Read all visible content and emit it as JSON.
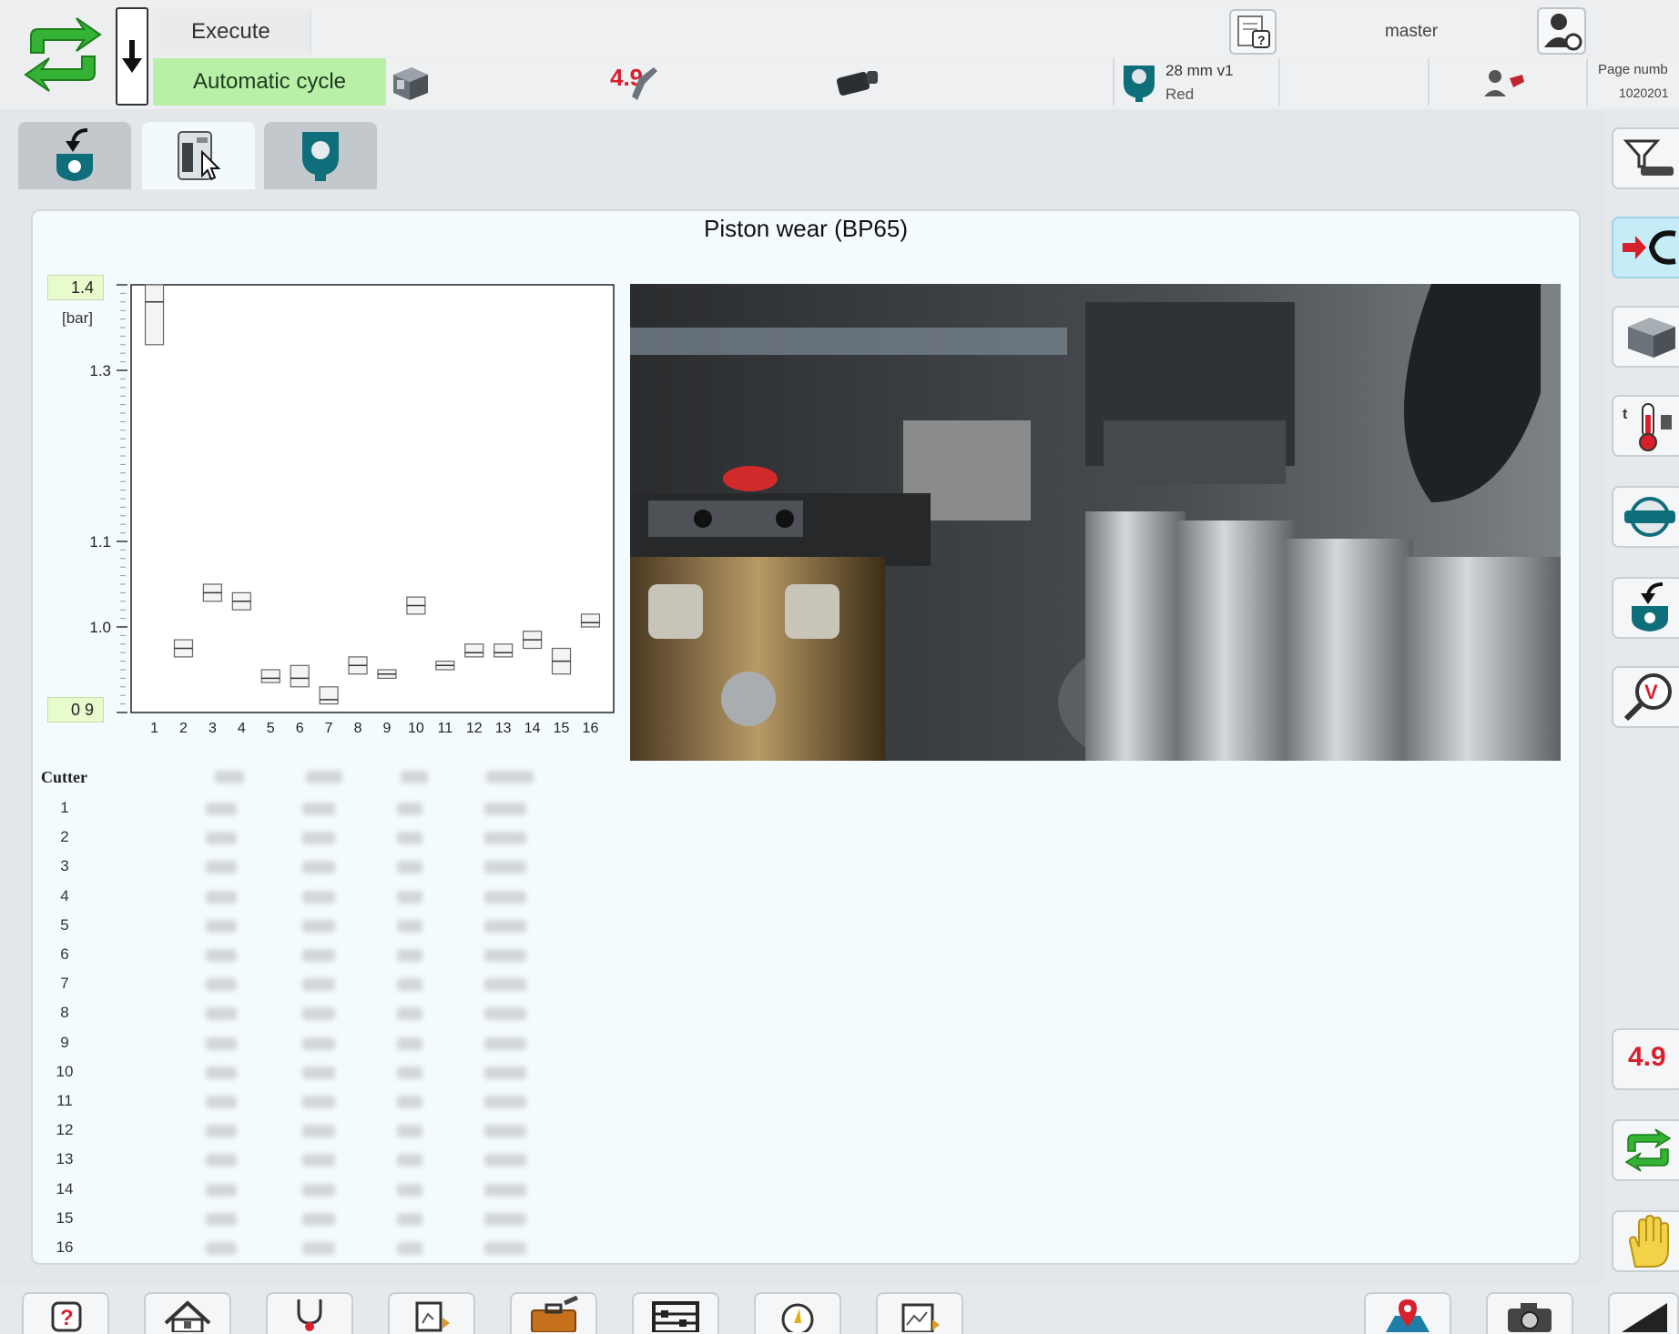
{
  "header": {
    "execute_label": "Execute",
    "mode_label": "Automatic cycle",
    "user_name": "master",
    "tool_line1": "28 mm v1",
    "tool_line2": "Red",
    "page_number_label": "Page numb",
    "page_number_value": "1020201",
    "tool_size_badge": "4.9"
  },
  "tabs": [
    {
      "name": "tool-change",
      "active": false
    },
    {
      "name": "machine-cabinet",
      "active": true
    },
    {
      "name": "spindle",
      "active": false
    }
  ],
  "panel": {
    "title": "Piston wear (BP65)"
  },
  "chart_data": {
    "type": "box",
    "title": "Piston wear (BP65)",
    "ylabel": "[bar]",
    "ylim": [
      0.9,
      1.4
    ],
    "ytick_labels": [
      "1.4",
      "1.3",
      "1.1",
      "1.0",
      "0 9"
    ],
    "yticks": [
      1.4,
      1.3,
      1.1,
      1.0,
      0.9
    ],
    "categories": [
      "1",
      "2",
      "3",
      "4",
      "5",
      "6",
      "7",
      "8",
      "9",
      "10",
      "11",
      "12",
      "13",
      "14",
      "15",
      "16"
    ],
    "boxes": [
      {
        "low": 1.33,
        "mid": 1.38,
        "high": 1.4
      },
      {
        "low": 0.965,
        "mid": 0.975,
        "high": 0.985
      },
      {
        "low": 1.03,
        "mid": 1.04,
        "high": 1.05
      },
      {
        "low": 1.02,
        "mid": 1.03,
        "high": 1.04
      },
      {
        "low": 0.935,
        "mid": 0.94,
        "high": 0.95
      },
      {
        "low": 0.93,
        "mid": 0.94,
        "high": 0.955
      },
      {
        "low": 0.91,
        "mid": 0.915,
        "high": 0.93
      },
      {
        "low": 0.945,
        "mid": 0.955,
        "high": 0.965
      },
      {
        "low": 0.94,
        "mid": 0.945,
        "high": 0.95
      },
      {
        "low": 1.015,
        "mid": 1.025,
        "high": 1.035
      },
      {
        "low": 0.95,
        "mid": 0.955,
        "high": 0.96
      },
      {
        "low": 0.965,
        "mid": 0.97,
        "high": 0.98
      },
      {
        "low": 0.965,
        "mid": 0.97,
        "high": 0.98
      },
      {
        "low": 0.975,
        "mid": 0.985,
        "high": 0.995
      },
      {
        "low": 0.945,
        "mid": 0.96,
        "high": 0.975
      },
      {
        "low": 1.0,
        "mid": 1.005,
        "high": 1.015
      }
    ]
  },
  "table": {
    "first_column_header": "Cutter",
    "rows": [
      "1",
      "2",
      "3",
      "4",
      "5",
      "6",
      "7",
      "8",
      "9",
      "10",
      "11",
      "12",
      "13",
      "14",
      "15",
      "16"
    ]
  },
  "colors": {
    "mode_green": "#b8f0a8",
    "brand_green": "#2eaa2e",
    "accent_red": "#d8202c",
    "active_blue": "#c6ecf7"
  },
  "right_rail_icons": [
    "funnel-icon",
    "sync-in-icon",
    "machine-icon",
    "temperature-icon",
    "valve-icon",
    "tool-change-icon",
    "inspect-icon",
    "drill-size-icon",
    "cycle-icon",
    "hand-stop-icon"
  ],
  "bottom_icons": [
    "help-icon",
    "home-icon",
    "stethoscope-icon",
    "diagram-icon",
    "toolbox-icon",
    "abacus-icon",
    "gauge-icon",
    "chart-doc-icon",
    "location-pin-icon",
    "camera-icon",
    "slope-icon"
  ]
}
